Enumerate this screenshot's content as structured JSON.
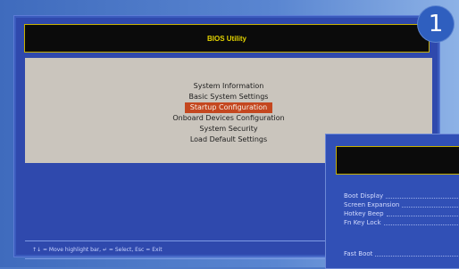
{
  "badge": "1",
  "bios": {
    "title": "BIOS Utility",
    "menu_items": [
      "System Information",
      "Basic System Settings",
      "Startup Configuration",
      "Onboard Devices Configuration",
      "System Security",
      "Load Default Settings"
    ],
    "selected_index": 2,
    "status_bar": "↑↓ = Move highlight bar, ↵ = Select, Esc = Exit"
  },
  "second_panel": {
    "items": [
      "Boot Display",
      "Screen Expansion",
      "Hotkey Beep",
      "Fn Key Lock"
    ],
    "extra_item": "Fast Boot"
  },
  "colors": {
    "background": "#4f7ac7",
    "panel": "#2f49ad",
    "menu_bg": "#cac5bd",
    "highlight": "#c4471f",
    "title_text": "#e4d400"
  }
}
